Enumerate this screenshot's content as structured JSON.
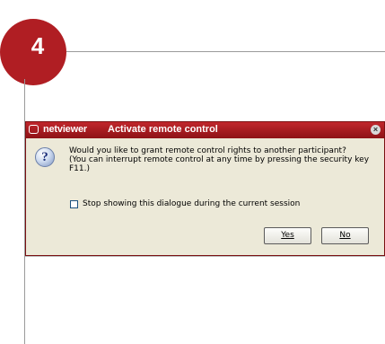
{
  "step": {
    "number": "4"
  },
  "dialog": {
    "brand": "netviewer",
    "title": "Activate remote control",
    "close_glyph": "×",
    "icon": "question-icon",
    "message_lines": [
      "Would you like to grant remote control rights to another participant?",
      "(You can interrupt remote control at any time by pressing the security key",
      "F11.)"
    ],
    "checkbox": {
      "label": "Stop showing this dialogue during the current session",
      "checked": false
    },
    "buttons": {
      "yes": "Yes",
      "no": "No"
    }
  },
  "colors": {
    "accent": "#b01e23",
    "titlebar": "#c0272c",
    "dialog_bg": "#ece9d8"
  }
}
